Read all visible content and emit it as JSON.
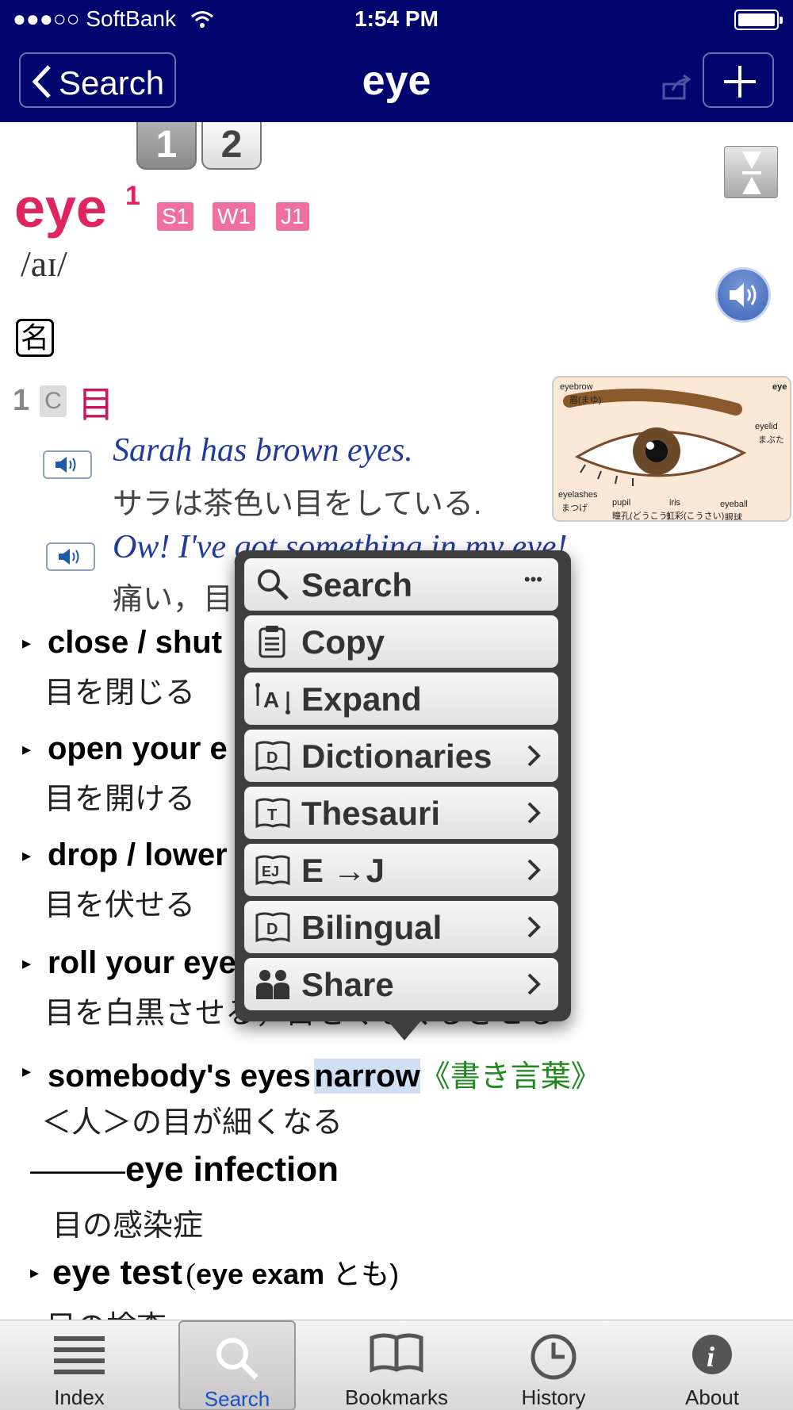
{
  "status_bar": {
    "carrier": "●●●○○ SoftBank",
    "time": "1:54 PM"
  },
  "nav": {
    "back_label": "Search",
    "title": "eye"
  },
  "entry": {
    "tabs": [
      "1",
      "2"
    ],
    "headword": "eye",
    "superscript": "1",
    "freq_labels": [
      "S1",
      "W1",
      "J1"
    ],
    "pronunciation": "/aɪ/",
    "pos": "名",
    "sense_number": "1",
    "sense_countable": "C",
    "sense_def": "目",
    "illustration_labels": {
      "eyebrow": "eyebrow",
      "eyebrow_ja": "眉(まゆ)",
      "eye": "eye",
      "eyelid": "eyelid",
      "eyelid_ja": "まぶた",
      "eyelashes": "eyelashes",
      "eyelashes_ja": "まつげ",
      "pupil": "pupil",
      "pupil_ja": "瞳孔(どうこう)",
      "iris": "iris",
      "iris_ja": "虹彩(こうさい)",
      "eyeball": "eyeball",
      "eyeball_ja": "眼球"
    },
    "examples": [
      {
        "en": "Sarah has brown eyes.",
        "ja": "サラは茶色い目をしている."
      },
      {
        "en": "Ow! I've got something in my eye!",
        "ja": "痛い，目に"
      }
    ],
    "phrases": [
      {
        "en": "close / shut",
        "ja": "目を閉じる"
      },
      {
        "en": "open your e",
        "ja": "目を開ける"
      },
      {
        "en": "drop / lower",
        "ja": "目を伏せる"
      },
      {
        "en": "roll your eye",
        "ja": "目を白黒させる，目をくるくるさせる"
      }
    ],
    "phrase5_en": "somebody's eyes",
    "phrase5_highlight": "narrow",
    "phrase5_tag": "《書き言葉》",
    "phrase5_ja": "＜人＞の目が細くなる",
    "compound_dash": "―――",
    "compound_en": "eye infection",
    "compound_ja": "目の感染症",
    "eyetest_en": "eye test",
    "eyetest_note_open": "(",
    "eyetest_note_en": "eye exam",
    "eyetest_note_ja": " とも)",
    "eyetest_ja": "目の検査"
  },
  "popup_menu": {
    "items": [
      {
        "label": "Search",
        "icon": "magnifier-icon",
        "more": "•••"
      },
      {
        "label": "Copy",
        "icon": "clipboard-icon"
      },
      {
        "label": "Expand",
        "icon": "expand-icon"
      },
      {
        "label": "Dictionaries",
        "icon": "dictionary-book-icon"
      },
      {
        "label": "Thesauri",
        "icon": "thesaurus-book-icon"
      },
      {
        "label": "E →J",
        "icon": "ej-book-icon"
      },
      {
        "label": "Bilingual",
        "icon": "bilingual-book-icon"
      },
      {
        "label": "Share",
        "icon": "people-icon"
      }
    ]
  },
  "tab_bar": {
    "items": [
      {
        "label": "Index",
        "icon": "list-icon"
      },
      {
        "label": "Search",
        "icon": "search-icon",
        "active": true
      },
      {
        "label": "Bookmarks",
        "icon": "book-icon"
      },
      {
        "label": "History",
        "icon": "clock-icon"
      },
      {
        "label": "About",
        "icon": "info-icon"
      }
    ]
  },
  "colors": {
    "nav_bg": "#00066e",
    "headword": "#e0245e",
    "example_en": "#1f3b9e",
    "tag_green": "#1e8a1e",
    "highlight": "#cfe0f4",
    "active_tab": "#1a50c8"
  }
}
